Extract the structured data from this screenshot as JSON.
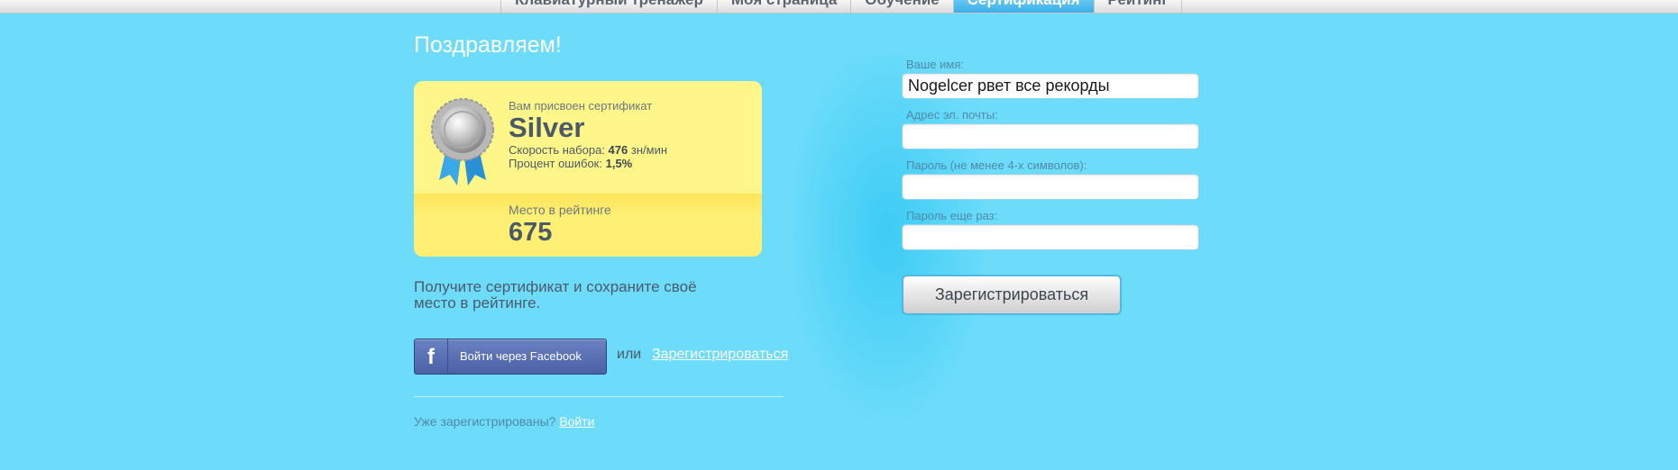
{
  "nav": {
    "tabs": [
      {
        "label": "Клавиатурный тренажер"
      },
      {
        "label": "Моя страница"
      },
      {
        "label": "Обучение"
      },
      {
        "label": "Сертификация",
        "active": true
      },
      {
        "label": "Рейтинг"
      }
    ]
  },
  "heading": "Поздравляем!",
  "certificate": {
    "label": "Вам присвоен сертификат",
    "level": "Silver",
    "speed_label": "Скорость набора:",
    "speed_value": "476",
    "speed_unit": "зн/мин",
    "errors_label": "Процент ошибок:",
    "errors_value": "1,5%",
    "rank_label": "Место в рейтинге",
    "rank_value": "675",
    "icon": "medal-icon"
  },
  "promo_text": "Получите сертификат и сохраните своё место в рейтинге.",
  "facebook_button": {
    "label": "Войти через Facebook",
    "icon": "facebook-icon"
  },
  "or_text": "или",
  "register_link": "Зарегистрироваться",
  "already": {
    "text": "Уже зарегистрированы?",
    "login_link": "Войти"
  },
  "form": {
    "name_label": "Ваше имя:",
    "name_value": "Nogelcer рвет все рекорды",
    "email_label": "Адрес эл. почты:",
    "email_value": "",
    "password_label": "Пароль (не менее 4-х символов):",
    "password_value": "",
    "password_repeat_label": "Пароль еще раз:",
    "password_repeat_value": "",
    "submit_label": "Зарегистрироваться"
  },
  "colors": {
    "background": "#6ddcfa",
    "active_tab": "#3aaee8",
    "card": "#fff68a",
    "facebook": "#4a62a6"
  }
}
